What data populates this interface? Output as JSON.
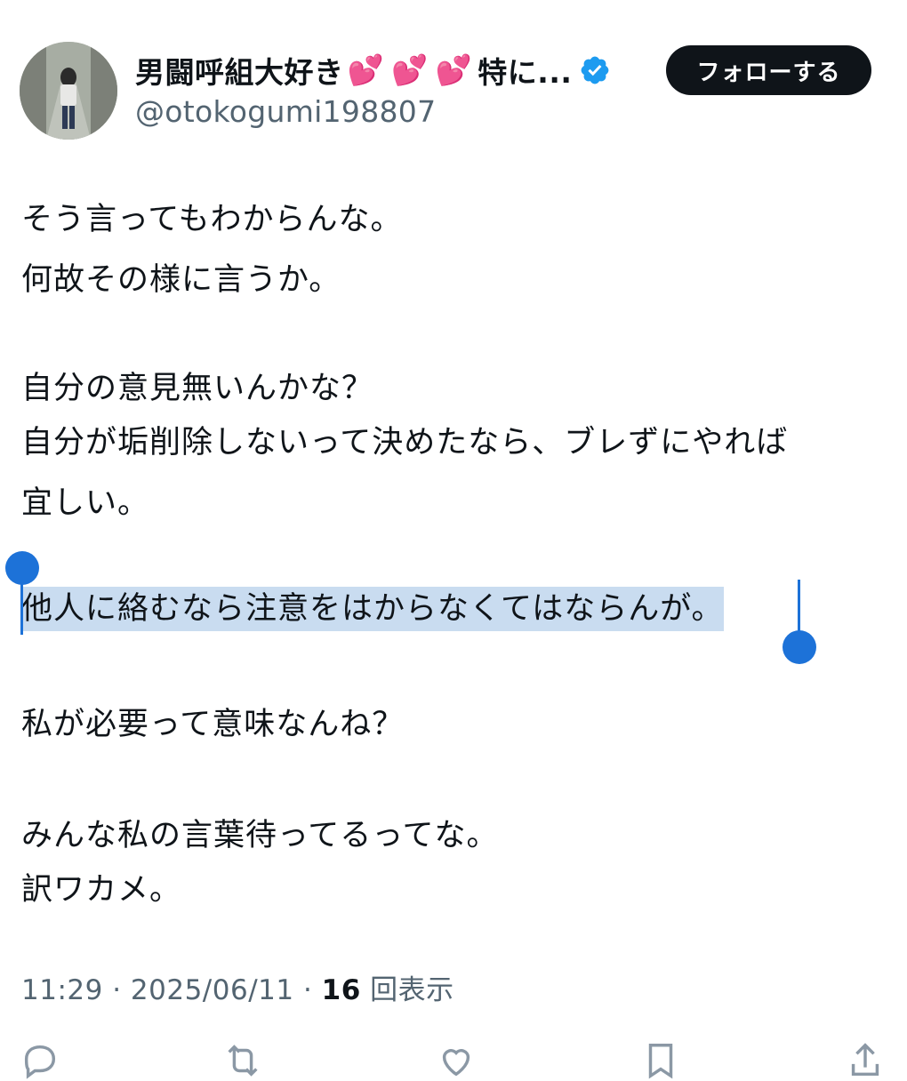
{
  "author": {
    "display_name_text": "男闘呼組大好き",
    "display_name_suffix": "特に...",
    "emoji": [
      "💕",
      "💕",
      "💕"
    ],
    "handle": "@otokogumi198807",
    "verified": true,
    "follow_label": "フォローする"
  },
  "tweet": {
    "lines": [
      "そう言ってもわからんな。",
      "何故その様に言うか。",
      "",
      "自分の意見無いんかな？",
      "自分が垢削除しないって決めたなら、ブレずにやれば",
      "宜しい。",
      "",
      "他人に絡むなら注意をはからなくてはならんが。",
      "",
      "私が必要って意味なんね？",
      "",
      "みんな私の言葉待ってるってな。",
      "訳ワカメ。"
    ],
    "selected_line": "他人に絡むなら注意をはからなくてはならんが。"
  },
  "meta": {
    "time": "11:29",
    "sep1": " · ",
    "date": "2025/06/11",
    "sep2": " · ",
    "views_count": "16",
    "views_label": "回表示"
  },
  "colors": {
    "verified": "#1d9bf0",
    "selection": "#c9dcf0",
    "selection_handle": "#1d72d8",
    "muted": "#536471",
    "text": "#0f1419"
  },
  "icons": [
    "reply-icon",
    "retweet-icon",
    "like-icon",
    "bookmark-icon",
    "share-icon"
  ]
}
